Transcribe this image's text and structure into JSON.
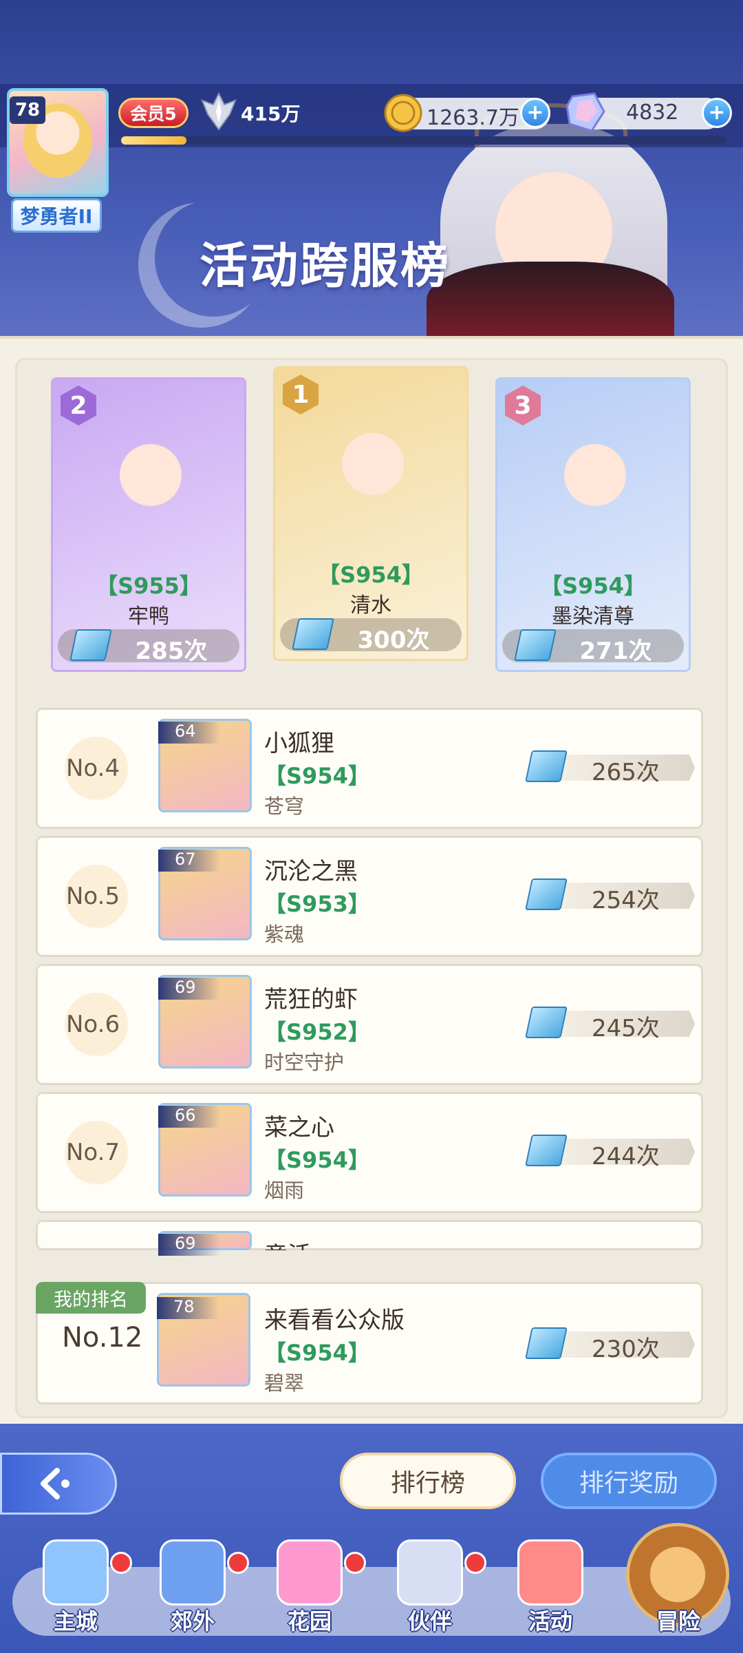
{
  "header": {
    "player_level": "78",
    "player_title": "梦勇者II",
    "vip_label": "会员5",
    "power": "415万",
    "exp_fraction": 0.108,
    "gold": "1263.7万",
    "gems": "4832",
    "page_title": "活动跨服榜"
  },
  "podium": [
    {
      "rank": "2",
      "server": "【S955】",
      "name": "牢鸭",
      "count": "285次",
      "bg": "#c9a8f3"
    },
    {
      "rank": "1",
      "server": "【S954】",
      "name": "清水",
      "count": "300次",
      "bg": "#f3d99a"
    },
    {
      "rank": "3",
      "server": "【S954】",
      "name": "墨染清尊",
      "count": "271次",
      "bg": "#b7cdf5"
    }
  ],
  "ranking": [
    {
      "rank": "No.4",
      "level": "64",
      "name": "小狐狸",
      "server": "【S954】",
      "guild": "苍穹",
      "count": "265次"
    },
    {
      "rank": "No.5",
      "level": "67",
      "name": "沉沦之黑",
      "server": "【S953】",
      "guild": "紫魂",
      "count": "254次"
    },
    {
      "rank": "No.6",
      "level": "69",
      "name": "荒狂的虾",
      "server": "【S952】",
      "guild": "时空守护",
      "count": "245次"
    },
    {
      "rank": "No.7",
      "level": "66",
      "name": "菜之心",
      "server": "【S954】",
      "guild": "烟雨",
      "count": "244次"
    },
    {
      "level": "69",
      "name": "竟活"
    }
  ],
  "my_rank": {
    "tag": "我的排名",
    "rank": "No.12",
    "level": "78",
    "name": "来看看公众版",
    "server": "【S954】",
    "guild": "碧翠",
    "count": "230次"
  },
  "buttons": {
    "leaderboard": "排行榜",
    "rank_reward": "排行奖励"
  },
  "nav": [
    {
      "label": "主城",
      "icon": "castle-icon",
      "badge": true
    },
    {
      "label": "郊外",
      "icon": "magic-circle-icon",
      "badge": true
    },
    {
      "label": "花园",
      "icon": "heart-icon",
      "badge": true
    },
    {
      "label": "伙伴",
      "icon": "partner-icon",
      "badge": true
    },
    {
      "label": "活动",
      "icon": "gift-icon",
      "badge": false
    },
    {
      "label": "冒险",
      "icon": "compass-icon",
      "badge": false
    }
  ],
  "colors": {
    "server_green": "#2f9a5c",
    "panel_bg": "#f4f0e6",
    "header_blue": "#3b4fa6"
  }
}
